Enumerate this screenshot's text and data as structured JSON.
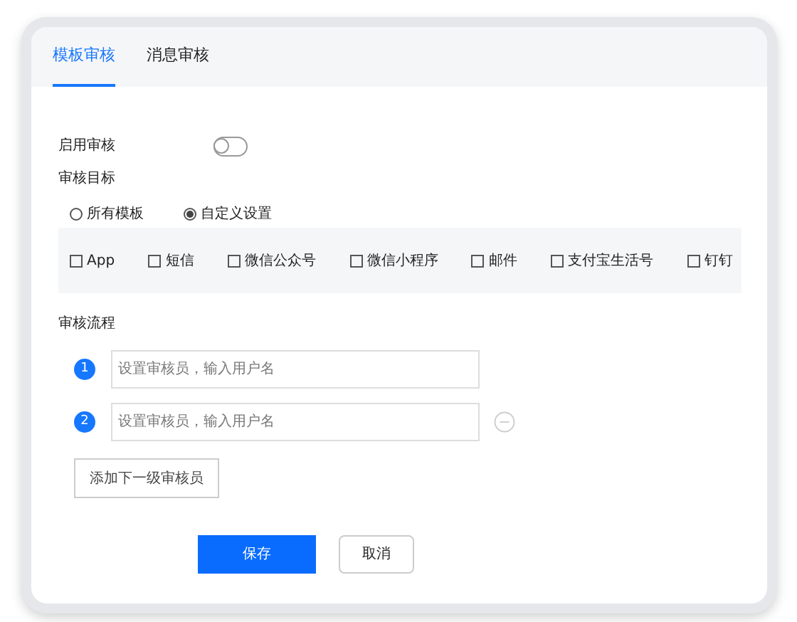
{
  "tabs": [
    {
      "label": "模板审核",
      "selected": true
    },
    {
      "label": "消息审核",
      "selected": false
    }
  ],
  "enable": {
    "label": "启用审核",
    "on": false
  },
  "target": {
    "label": "审核目标",
    "options": [
      {
        "label": "所有模板",
        "selected": false
      },
      {
        "label": "自定义设置",
        "selected": true
      }
    ],
    "channels": [
      {
        "label": "App",
        "checked": false
      },
      {
        "label": "短信",
        "checked": false
      },
      {
        "label": "微信公众号",
        "checked": false
      },
      {
        "label": "微信小程序",
        "checked": false
      },
      {
        "label": "邮件",
        "checked": false
      },
      {
        "label": "支付宝生活号",
        "checked": false
      },
      {
        "label": "钉钉",
        "checked": false
      }
    ]
  },
  "flow": {
    "label": "审核流程",
    "steps": [
      {
        "number": "1",
        "placeholder": "设置审核员，输入用户名",
        "removable": false
      },
      {
        "number": "2",
        "placeholder": "设置审核员，输入用户名",
        "removable": true
      }
    ],
    "add_button": "添加下一级审核员"
  },
  "buttons": [
    {
      "label": "保存",
      "kind": "primary"
    },
    {
      "label": "取消",
      "kind": "secondary"
    }
  ]
}
